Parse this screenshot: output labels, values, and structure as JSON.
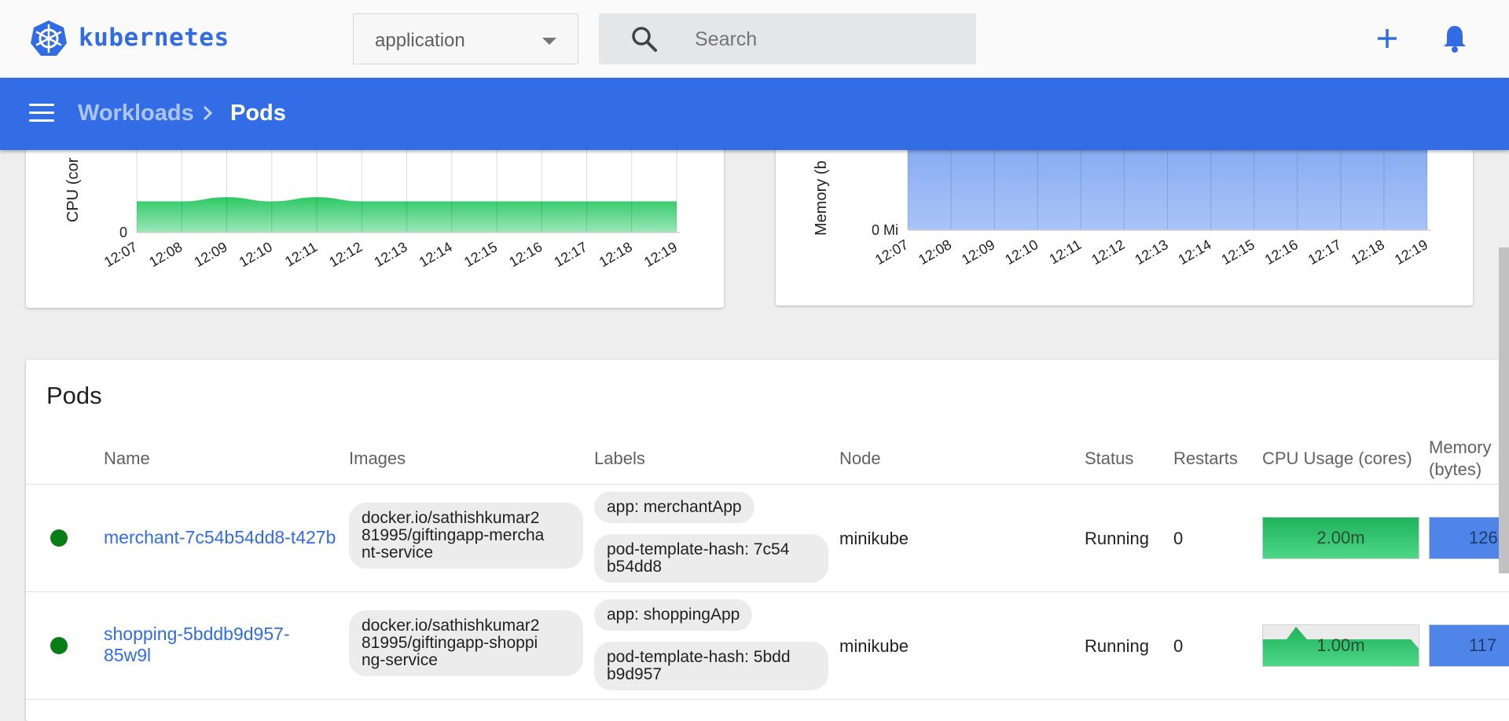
{
  "app": {
    "brand": "kubernetes",
    "namespace": "application",
    "search_placeholder": "Search",
    "brand_color": "#326ce5"
  },
  "breadcrumb": {
    "parent": "Workloads",
    "current": "Pods"
  },
  "icons": [
    "kubernetes-logo",
    "search-icon",
    "add-icon",
    "notifications-icon",
    "menu-icon",
    "chevron-right-icon"
  ],
  "chart_data": [
    {
      "type": "area",
      "title": "",
      "xlabel": "",
      "ylabel": "CPU (cor",
      "x": [
        "12:07",
        "12:08",
        "12:09",
        "12:10",
        "12:11",
        "12:12",
        "12:13",
        "12:14",
        "12:15",
        "12:16",
        "12:17",
        "12:18",
        "12:19"
      ],
      "y_ticks": [
        "0"
      ],
      "series": [
        {
          "values": [
            3.0,
            3.0,
            3.4,
            3.0,
            3.4,
            3.0,
            3.0,
            3.0,
            3.0,
            3.0,
            3.0,
            3.0,
            3.0
          ]
        }
      ],
      "ylim": [
        0,
        5
      ],
      "grid": true,
      "color": "#2ec866"
    },
    {
      "type": "area",
      "title": "",
      "xlabel": "",
      "ylabel": "Memory (b",
      "x": [
        "12:07",
        "12:08",
        "12:09",
        "12:10",
        "12:11",
        "12:12",
        "12:13",
        "12:14",
        "12:15",
        "12:16",
        "12:17",
        "12:18",
        "12:19"
      ],
      "y_ticks": [
        "0 Mi"
      ],
      "series": [
        {
          "values": [
            250,
            250,
            250,
            250,
            250,
            250,
            250,
            250,
            250,
            250,
            250,
            250,
            250
          ]
        }
      ],
      "ylim": [
        0,
        250
      ],
      "grid": true,
      "color": "#7fa6f0"
    }
  ],
  "pods": {
    "title": "Pods",
    "columns": [
      "Name",
      "Images",
      "Labels",
      "Node",
      "Status",
      "Restarts",
      "CPU Usage (cores)",
      "Memory",
      "(bytes)"
    ],
    "rows": [
      {
        "name": "merchant-7c54b54dd8-t427b",
        "image_lines": [
          "docker.io/sathishkumar2",
          "81995/giftingapp-mercha",
          "nt-service"
        ],
        "label1": "app: merchantApp",
        "label2_lines": [
          "pod-template-hash: 7c54",
          "b54dd8"
        ],
        "node": "minikube",
        "status": "Running",
        "restarts": "0",
        "cpu": "2.00m",
        "cpu_fraction": 1.0,
        "memory": "126"
      },
      {
        "name_lines": [
          "shopping-5bddb9d957-",
          "85w9l"
        ],
        "image_lines": [
          "docker.io/sathishkumar2",
          "81995/giftingapp-shoppi",
          "ng-service"
        ],
        "label1": "app: shoppingApp",
        "label2_lines": [
          "pod-template-hash: 5bdd",
          "b9d957"
        ],
        "node": "minikube",
        "status": "Running",
        "restarts": "0",
        "cpu": "1.00m",
        "cpu_fraction": 0.5,
        "memory": "117"
      }
    ]
  }
}
